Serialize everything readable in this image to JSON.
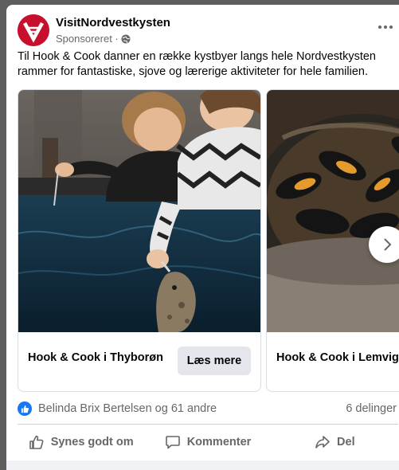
{
  "post": {
    "page_name": "VisitNordvestkysten",
    "sponsored_label": "Sponsoreret ·",
    "text": "Til Hook & Cook danner en række kystbyer langs hele Nordvestkysten rammer for fantastiske, sjove og lærerige aktiviteter for hele familien."
  },
  "carousel": {
    "cards": [
      {
        "title": "Hook & Cook i Thyborøn",
        "cta_label": "Læs mere"
      },
      {
        "title": "Hook & Cook i Lemvig"
      }
    ]
  },
  "reactions": {
    "names": "Belinda Brix Bertelsen og 61 andre",
    "shares": "6 delinger"
  },
  "actions": {
    "like_label": "Synes godt om",
    "comment_label": "Kommenter",
    "share_label": "Del"
  },
  "colors": {
    "brand_red": "#c8102e",
    "like_blue": "#1877f2",
    "secondary_text": "#65676b"
  },
  "icons": [
    "more-icon",
    "globe-icon",
    "chevron-right-icon",
    "like-icon",
    "comment-icon",
    "share-icon"
  ]
}
